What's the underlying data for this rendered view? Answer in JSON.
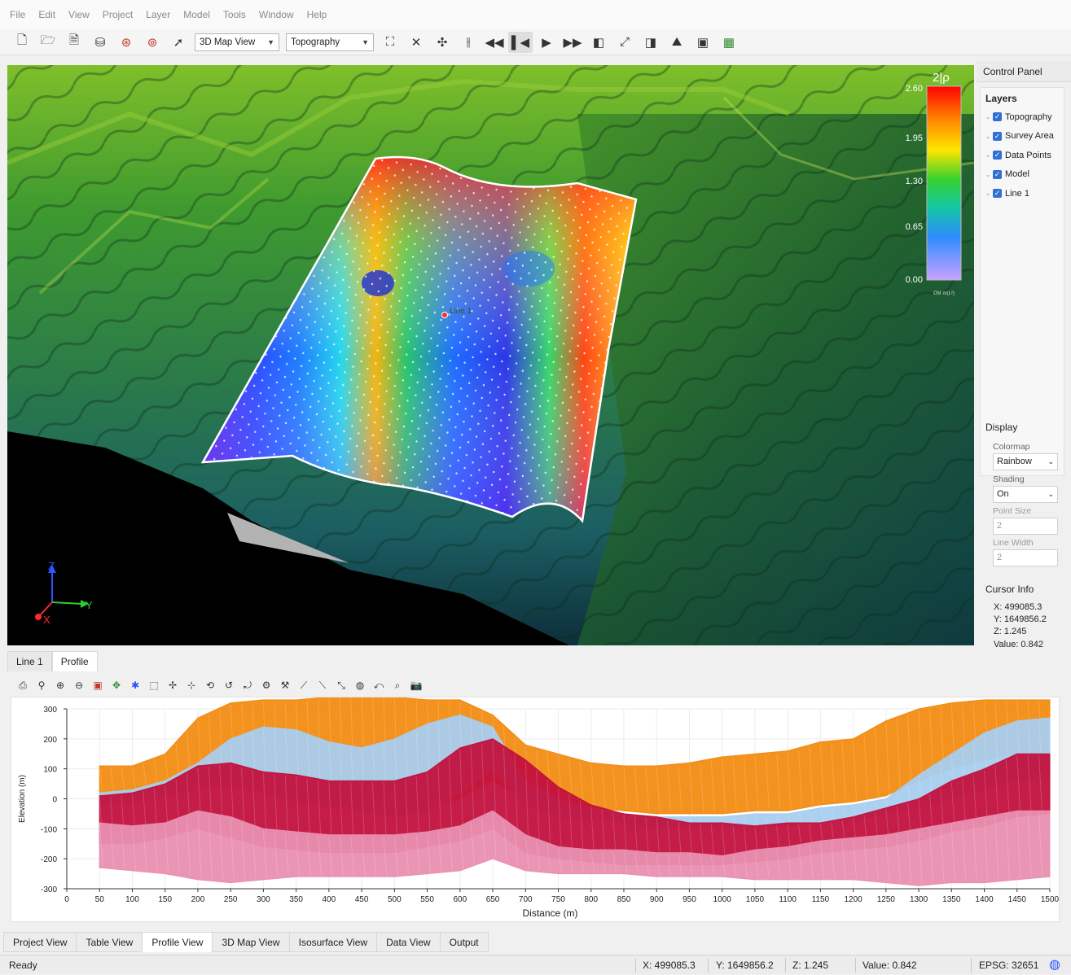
{
  "menu": [
    "File",
    "Edit",
    "View",
    "Project",
    "Layer",
    "Model",
    "Tools",
    "Window",
    "Help"
  ],
  "toolbar": {
    "view_select": "3D Map View",
    "layer_select": "Topography"
  },
  "viewport": {
    "line_label": "Line 1",
    "colorbar": {
      "ticks": [
        "2.60",
        "1.95",
        "1.30",
        "0.65",
        "0.00"
      ],
      "header": "2|ρ",
      "credit": "ΩM·m(L²)"
    },
    "axes": {
      "z": "Z",
      "y": "Y",
      "x": "X"
    }
  },
  "control_panel": {
    "title": "Control Panel",
    "layers_title": "Layers",
    "layers": [
      "Topography",
      "Survey Area",
      "Data Points",
      "Model",
      "Line 1"
    ],
    "display_title": "Display",
    "colormap_label": "Colormap",
    "colormap_value": "Rainbow",
    "shading_label": "Shading",
    "shading_value": "On",
    "point_size_label": "Point Size",
    "point_size_value": "2",
    "line_width_label": "Line Width",
    "line_width_value": "2",
    "cursor_title": "Cursor Info",
    "cursor": {
      "x": "X:  499085.3",
      "y": "Y:  1649856.2",
      "z": "Z:     1.245",
      "value": "Value:  0.842"
    }
  },
  "profile_tabs": [
    "Line 1",
    "Profile"
  ],
  "chart_data": {
    "type": "scatter",
    "title": "",
    "xlabel": "Distance (m)",
    "ylabel": "Elevation (m)",
    "xlim": [
      0,
      1500
    ],
    "ylim": [
      -300,
      300
    ],
    "x_ticks": [
      0,
      50,
      100,
      150,
      200,
      250,
      300,
      350,
      400,
      450,
      500,
      550,
      600,
      650,
      700,
      750,
      800,
      850,
      900,
      950,
      1000,
      1050,
      1100,
      1150,
      1200,
      1250,
      1300,
      1350,
      1400,
      1450,
      1500
    ],
    "y_ticks": [
      300,
      200,
      100,
      0,
      -100,
      -200,
      -300
    ],
    "grid": true,
    "legend": "none",
    "series": [
      {
        "color": "#f28c12",
        "x": [
          50,
          100,
          150,
          200,
          250,
          300,
          350,
          400,
          450,
          500,
          550,
          600,
          650,
          700,
          750,
          800,
          850,
          900,
          950,
          1000,
          1050,
          1100,
          1150,
          1200,
          1250,
          1300,
          1350,
          1400,
          1450,
          1500
        ],
        "top": [
          110,
          110,
          150,
          270,
          320,
          330,
          330,
          340,
          350,
          340,
          330,
          330,
          280,
          180,
          150,
          120,
          110,
          110,
          120,
          140,
          150,
          160,
          190,
          200,
          260,
          300,
          320,
          330,
          330,
          330
        ],
        "bottom": [
          10,
          20,
          50,
          80,
          100,
          60,
          20,
          20,
          20,
          0,
          -20,
          0,
          60,
          0,
          -20,
          -30,
          -40,
          -50,
          -50,
          -50,
          -40,
          -40,
          -20,
          -10,
          10,
          60,
          100,
          130,
          150,
          150
        ]
      },
      {
        "color": "#a8cdef",
        "x": [
          50,
          100,
          150,
          200,
          250,
          300,
          350,
          400,
          450,
          500,
          550,
          600,
          650,
          700,
          750,
          800,
          850,
          900,
          950,
          1000,
          1050,
          1100,
          1150,
          1200,
          1250,
          1300,
          1350,
          1400,
          1450,
          1500
        ],
        "top": [
          20,
          30,
          60,
          120,
          200,
          240,
          230,
          190,
          170,
          200,
          250,
          280,
          240,
          60,
          0,
          -40,
          -50,
          -60,
          -60,
          -60,
          -50,
          -50,
          -30,
          -20,
          0,
          80,
          150,
          220,
          260,
          270
        ],
        "bottom": [
          -20,
          -10,
          10,
          30,
          40,
          20,
          -10,
          -30,
          -40,
          -60,
          -40,
          20,
          100,
          -20,
          -60,
          -70,
          -80,
          -100,
          -100,
          -100,
          -100,
          -90,
          -80,
          -70,
          -50,
          -30,
          0,
          30,
          60,
          70
        ]
      },
      {
        "color": "#c2113e",
        "x": [
          50,
          100,
          150,
          200,
          250,
          300,
          350,
          400,
          450,
          500,
          550,
          600,
          650,
          700,
          750,
          800,
          850,
          900,
          950,
          1000,
          1050,
          1100,
          1150,
          1200,
          1250,
          1300,
          1350,
          1400,
          1450,
          1500
        ],
        "top": [
          10,
          20,
          50,
          110,
          120,
          90,
          80,
          60,
          60,
          60,
          90,
          170,
          200,
          130,
          40,
          -20,
          -50,
          -60,
          -80,
          -80,
          -90,
          -80,
          -80,
          -60,
          -30,
          0,
          60,
          100,
          150,
          150
        ],
        "bottom": [
          -150,
          -150,
          -130,
          -100,
          -130,
          -160,
          -170,
          -180,
          -180,
          -180,
          -160,
          -140,
          -100,
          -180,
          -200,
          -210,
          -220,
          -220,
          -220,
          -220,
          -210,
          -200,
          -180,
          -170,
          -160,
          -140,
          -110,
          -90,
          -60,
          -50
        ]
      },
      {
        "color": "#e98fb0",
        "x": [
          50,
          100,
          150,
          200,
          250,
          300,
          350,
          400,
          450,
          500,
          550,
          600,
          650,
          700,
          750,
          800,
          850,
          900,
          950,
          1000,
          1050,
          1100,
          1150,
          1200,
          1250,
          1300,
          1350,
          1400,
          1450,
          1500
        ],
        "top": [
          -80,
          -90,
          -80,
          -40,
          -60,
          -100,
          -110,
          -120,
          -120,
          -120,
          -110,
          -90,
          -40,
          -120,
          -160,
          -170,
          -170,
          -180,
          -180,
          -190,
          -170,
          -160,
          -140,
          -130,
          -120,
          -100,
          -80,
          -60,
          -40,
          -40
        ],
        "bottom": [
          -230,
          -240,
          -250,
          -270,
          -280,
          -270,
          -260,
          -260,
          -260,
          -260,
          -250,
          -240,
          -200,
          -240,
          -250,
          -250,
          -250,
          -260,
          -260,
          -260,
          -270,
          -270,
          -270,
          -270,
          -280,
          -290,
          -280,
          -280,
          -270,
          -260
        ]
      }
    ]
  },
  "view_tabs": [
    "Project View",
    "Table View",
    "Profile View",
    "3D Map View",
    "Isosurface View",
    "Data View",
    "Output"
  ],
  "status": {
    "ready": "Ready",
    "x": "X: 499085.3",
    "y": "Y: 1649856.2",
    "z": "Z: 1.245",
    "value": "Value: 0.842",
    "epsg": "EPSG: 32651"
  }
}
